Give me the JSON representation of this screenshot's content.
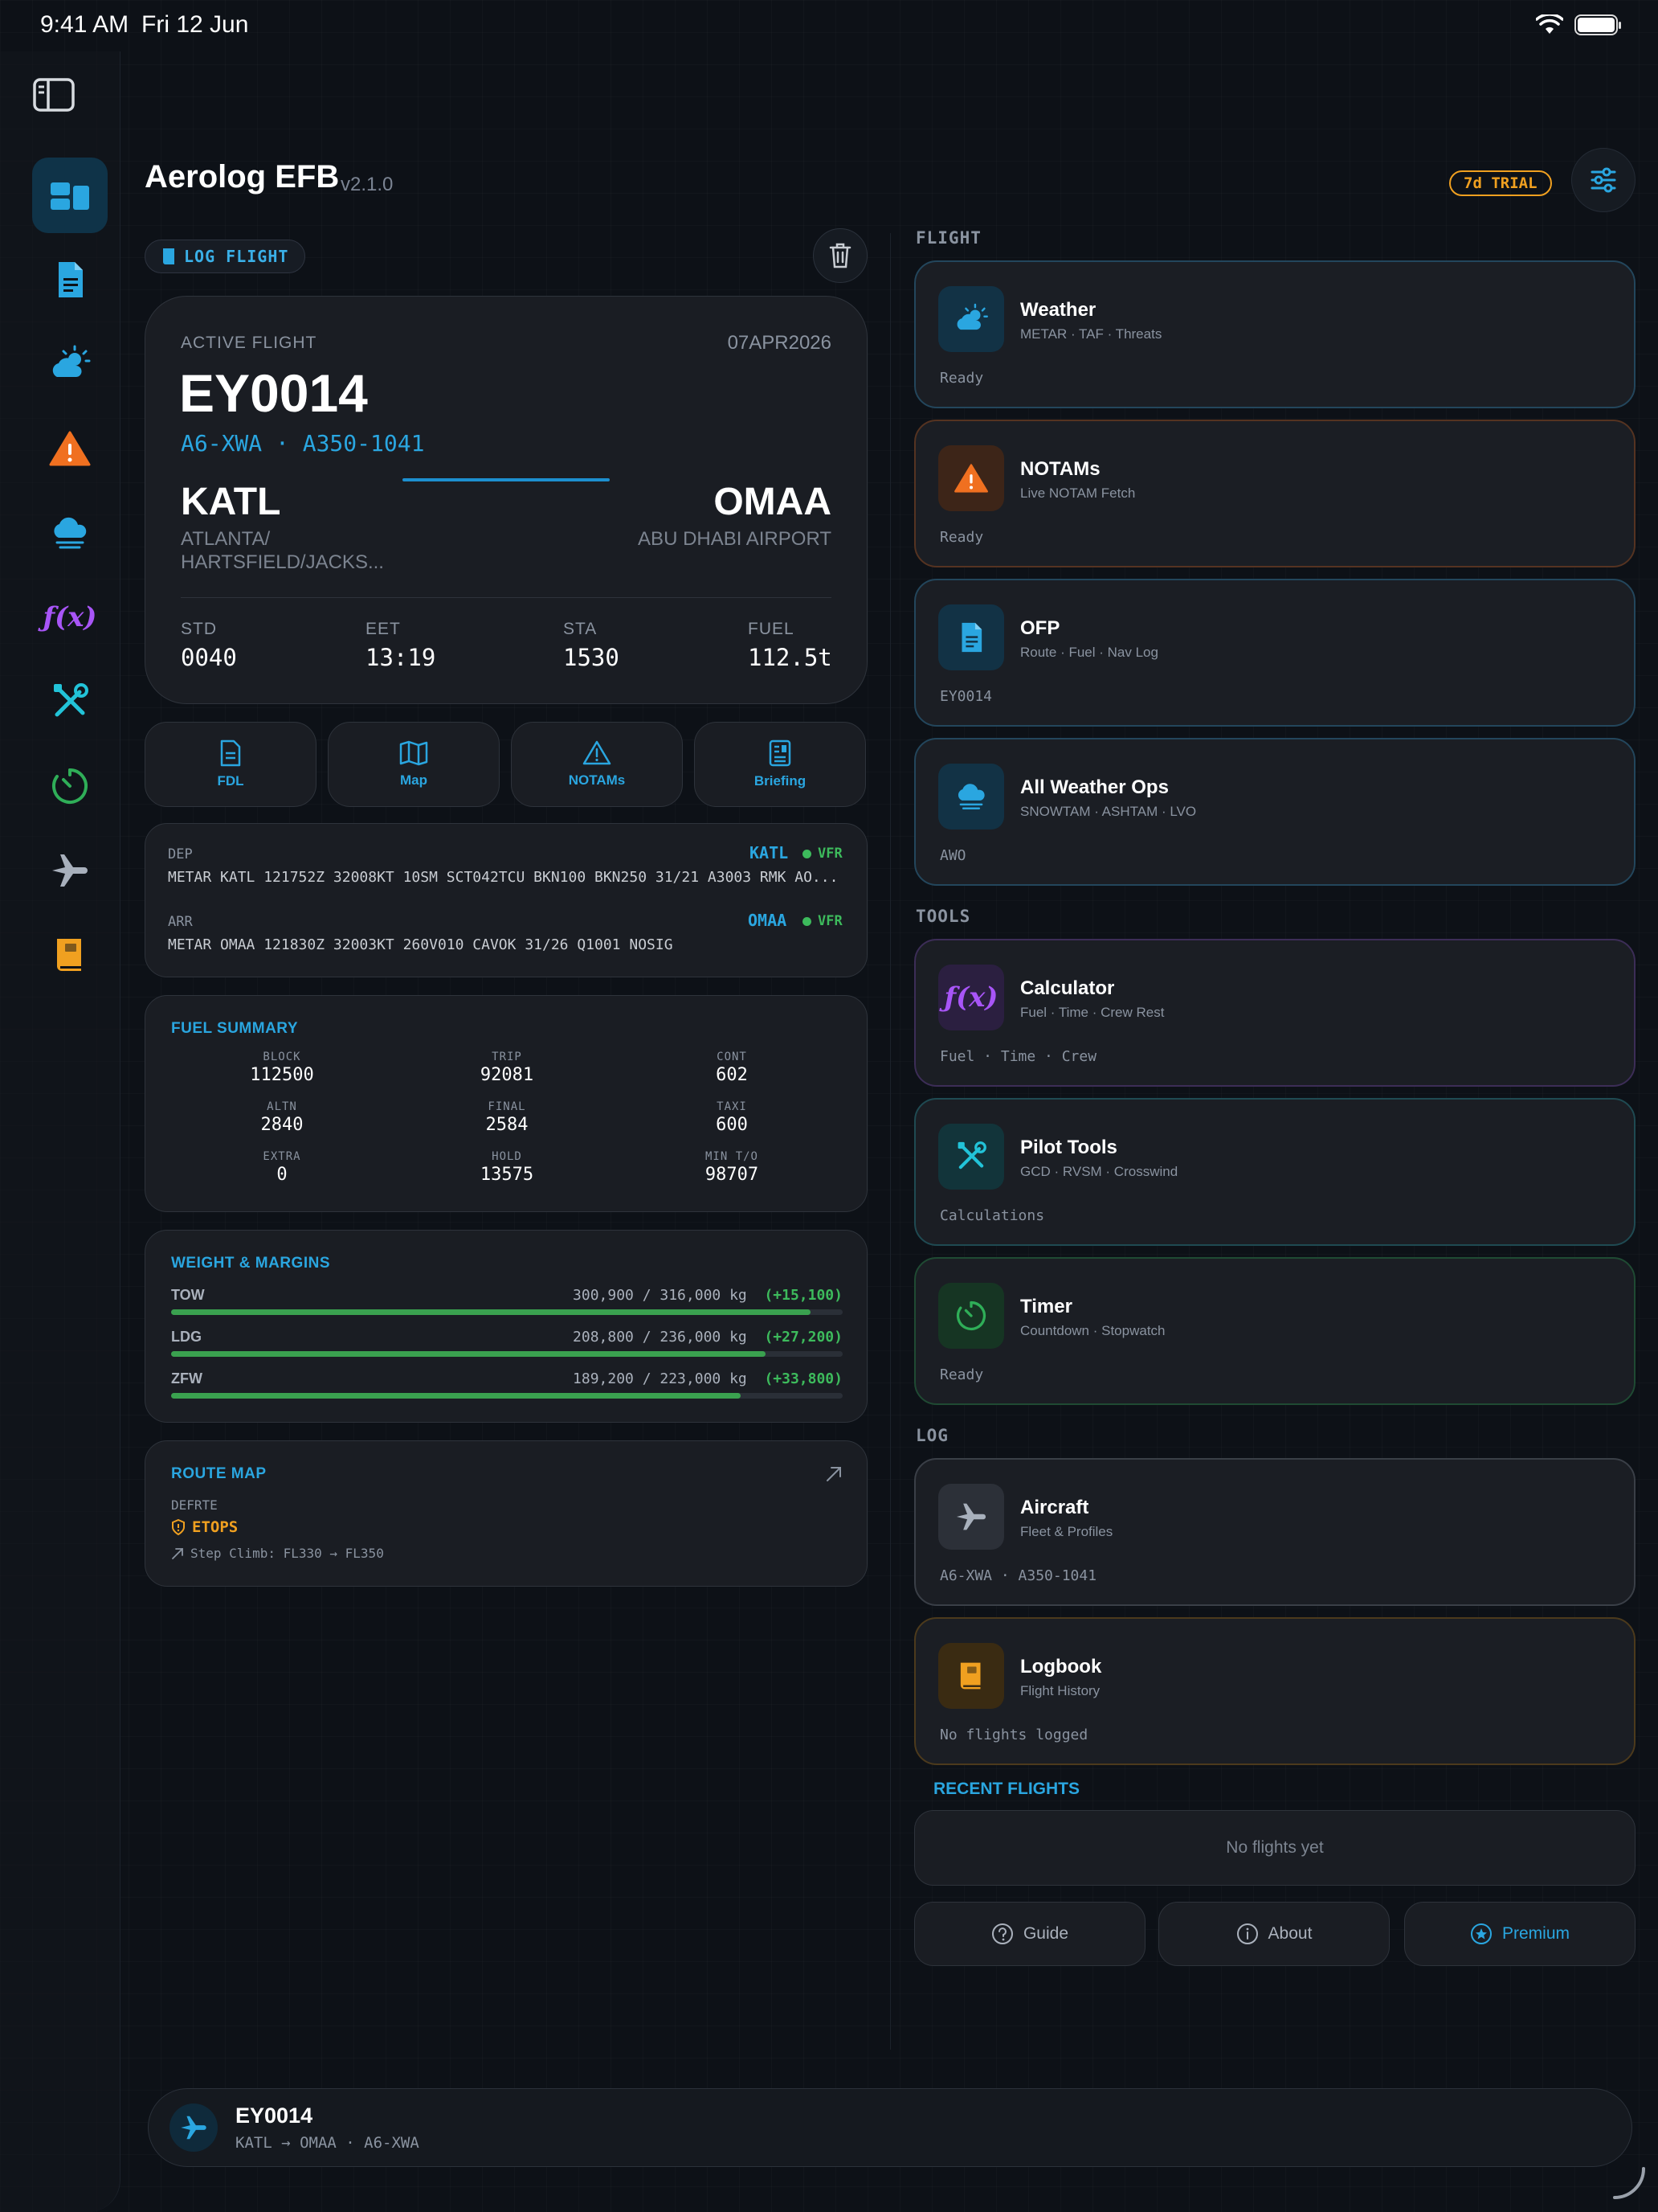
{
  "status_bar": {
    "time": "9:41 AM",
    "date": "Fri 12 Jun"
  },
  "sidebar": {
    "items": [
      {
        "name": "dashboard",
        "icon": "dashboard-icon",
        "active": true
      },
      {
        "name": "ofp",
        "icon": "document-icon"
      },
      {
        "name": "weather",
        "icon": "cloud-sun-icon"
      },
      {
        "name": "notams",
        "icon": "warning-icon"
      },
      {
        "name": "all-weather-ops",
        "icon": "cloud-fog-icon"
      },
      {
        "name": "calculator",
        "icon": "function-icon",
        "label": "ƒ(x)"
      },
      {
        "name": "pilot-tools",
        "icon": "tools-icon"
      },
      {
        "name": "timer",
        "icon": "timer-icon"
      },
      {
        "name": "aircraft",
        "icon": "airplane-icon"
      },
      {
        "name": "logbook",
        "icon": "book-icon"
      }
    ]
  },
  "header": {
    "title": "Aerolog EFB",
    "version": "v2.1.0",
    "trial_badge": "7d TRIAL"
  },
  "log_flight_label": "LOG FLIGHT",
  "active_flight": {
    "label": "ACTIVE FLIGHT",
    "date": "07APR2026",
    "flight_number": "EY0014",
    "registration_type": "A6-XWA · A350-1041",
    "dep_icao": "KATL",
    "dep_name": "ATLANTA/ HARTSFIELD/JACKS...",
    "arr_icao": "OMAA",
    "arr_name": "ABU DHABI AIRPORT",
    "stats": [
      {
        "label": "STD",
        "value": "0040"
      },
      {
        "label": "EET",
        "value": "13:19"
      },
      {
        "label": "STA",
        "value": "1530"
      },
      {
        "label": "FUEL",
        "value": "112.5t"
      }
    ]
  },
  "quick_actions": [
    {
      "label": "FDL",
      "icon": "document-icon"
    },
    {
      "label": "Map",
      "icon": "map-icon"
    },
    {
      "label": "NOTAMs",
      "icon": "warning-icon"
    },
    {
      "label": "Briefing",
      "icon": "briefing-icon"
    }
  ],
  "metar": {
    "dep": {
      "label": "DEP",
      "icao": "KATL",
      "category": "VFR",
      "text": "METAR KATL 121752Z 32008KT 10SM SCT042TCU BKN100 BKN250 31/21 A3003 RMK AO..."
    },
    "arr": {
      "label": "ARR",
      "icao": "OMAA",
      "category": "VFR",
      "text": "METAR OMAA 121830Z 32003KT 260V010 CAVOK 31/26 Q1001 NOSIG"
    }
  },
  "fuel_summary": {
    "title": "FUEL SUMMARY",
    "cells": [
      {
        "label": "BLOCK",
        "value": "112500"
      },
      {
        "label": "TRIP",
        "value": "92081"
      },
      {
        "label": "CONT",
        "value": "602"
      },
      {
        "label": "ALTN",
        "value": "2840"
      },
      {
        "label": "FINAL",
        "value": "2584"
      },
      {
        "label": "TAXI",
        "value": "600"
      },
      {
        "label": "EXTRA",
        "value": "0"
      },
      {
        "label": "HOLD",
        "value": "13575"
      },
      {
        "label": "MIN T/O",
        "value": "98707"
      }
    ]
  },
  "weights": {
    "title": "WEIGHT & MARGINS",
    "rows": [
      {
        "name": "TOW",
        "values": "300,900 / 316,000 kg",
        "margin": "(+15,100)",
        "fraction": 0.952
      },
      {
        "name": "LDG",
        "values": "208,800 / 236,000 kg",
        "margin": "(+27,200)",
        "fraction": 0.885
      },
      {
        "name": "ZFW",
        "values": "189,200 / 223,000 kg",
        "margin": "(+33,800)",
        "fraction": 0.848
      }
    ]
  },
  "route_map": {
    "title": "ROUTE MAP",
    "sub": "DEFRTE",
    "etops": "ETOPS",
    "step_climb": "Step Climb: FL330 → FL350"
  },
  "groups": {
    "flight": "FLIGHT",
    "tools": "TOOLS",
    "log": "LOG"
  },
  "tiles": [
    {
      "title": "Weather",
      "sub": "METAR · TAF · Threats",
      "status": "Ready",
      "icon": "cloud-sun-icon",
      "accent": "#2aa6e0"
    },
    {
      "title": "NOTAMs",
      "sub": "Live NOTAM Fetch",
      "status": "Ready",
      "icon": "warning-icon",
      "accent": "#f07020"
    },
    {
      "title": "OFP",
      "sub": "Route · Fuel · Nav Log",
      "status": "EY0014",
      "icon": "document-icon",
      "accent": "#2aa6e0"
    },
    {
      "title": "All Weather Ops",
      "sub": "SNOWTAM · ASHTAM · LVO",
      "status": "AWO",
      "icon": "cloud-fog-icon",
      "accent": "#2aa6e0"
    },
    {
      "title": "Calculator",
      "sub": "Fuel · Time · Crew Rest",
      "status": "Fuel · Time · Crew",
      "icon": "function-icon",
      "accent": "#a855f7",
      "icon_label": "ƒ(x)"
    },
    {
      "title": "Pilot Tools",
      "sub": "GCD · RVSM · Crosswind",
      "status": "Calculations",
      "icon": "tools-icon",
      "accent": "#22c3d8"
    },
    {
      "title": "Timer",
      "sub": "Countdown · Stopwatch",
      "status": "Ready",
      "icon": "timer-icon",
      "accent": "#2fae58"
    },
    {
      "title": "Aircraft",
      "sub": "Fleet & Profiles",
      "status": "A6-XWA · A350-1041",
      "icon": "airplane-icon",
      "accent": "#8a93a0"
    },
    {
      "title": "Logbook",
      "sub": "Flight History",
      "status": "No flights logged",
      "icon": "book-icon",
      "accent": "#f0a020"
    }
  ],
  "recent_flights": {
    "title": "RECENT FLIGHTS",
    "empty": "No flights yet"
  },
  "bottom_buttons": [
    {
      "label": "Guide",
      "icon": "help-icon"
    },
    {
      "label": "About",
      "icon": "info-icon"
    },
    {
      "label": "Premium",
      "icon": "star-icon"
    }
  ],
  "flight_bar": {
    "title": "EY0014",
    "sub": "KATL → OMAA · A6-XWA"
  },
  "colors": {
    "accent": "#2aa6e0",
    "background": "#0d1117",
    "card": "#1a1d23",
    "warning": "#f0a020",
    "success": "#3dba5c"
  }
}
